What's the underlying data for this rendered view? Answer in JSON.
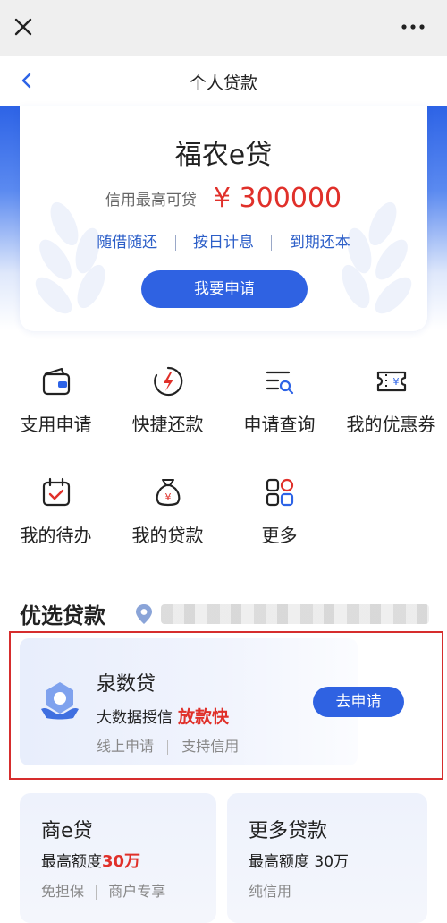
{
  "window": {
    "close_icon": "close-icon",
    "more_icon": "more-icon"
  },
  "nav": {
    "title": "个人贷款",
    "back_icon": "chevron-left-icon"
  },
  "hero": {
    "product_name": "福农e贷",
    "limit_label": "信用最高可贷",
    "limit_value": "¥ 300000",
    "features": [
      "随借随还",
      "按日计息",
      "到期还本"
    ],
    "apply_label": "我要申请"
  },
  "entries": [
    {
      "label": "支用申请",
      "icon": "wallet-icon"
    },
    {
      "label": "快捷还款",
      "icon": "lightning-icon"
    },
    {
      "label": "申请查询",
      "icon": "search-list-icon"
    },
    {
      "label": "我的优惠券",
      "icon": "coupon-icon"
    },
    {
      "label": "我的待办",
      "icon": "calendar-check-icon"
    },
    {
      "label": "我的贷款",
      "icon": "money-bag-icon"
    },
    {
      "label": "更多",
      "icon": "grid-icon"
    }
  ],
  "section": {
    "title": "优选贷款",
    "location_icon": "location-pin-icon"
  },
  "featured": {
    "name": "泉数贷",
    "desc": "大数据授信",
    "highlight": "放款快",
    "tags": [
      "线上申请",
      "支持信用"
    ],
    "apply_label": "去申请"
  },
  "cards": [
    {
      "title": "商e贷",
      "limit_prefix": "最高额度",
      "limit_value": "30万",
      "tags": [
        "免担保",
        "商户专享"
      ]
    },
    {
      "title": "更多贷款",
      "limit_text": "最高额度 30万",
      "tags": [
        "纯信用"
      ]
    }
  ],
  "colors": {
    "brand_blue": "#2f62e2",
    "accent_red": "#e0302a",
    "highlight_border": "#d62d2d"
  }
}
